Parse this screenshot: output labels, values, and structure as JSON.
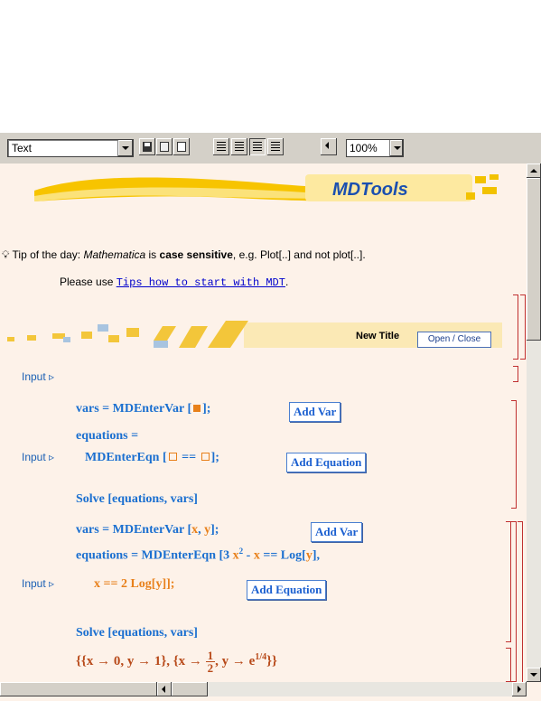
{
  "toolbar": {
    "style_value": "Text",
    "zoom_value": "100%"
  },
  "banner": {
    "logo_text": "MDTools"
  },
  "tip": {
    "prefix": "Tip of the day: ",
    "app": "Mathematica",
    "mid": " is ",
    "bold": "case sensitive",
    "suffix": ", e.g. Plot[..] and not plot[..]."
  },
  "please": {
    "prefix": "Please use ",
    "link": "Tips how to start with MDT",
    "suffix": "."
  },
  "section": {
    "title": "New Title",
    "open_close": "Open / Close"
  },
  "cells": {
    "input_label": "Input ▹",
    "cell1": {
      "vars_a": "vars = MDEnterVar [",
      "vars_b": "];",
      "add_var": "Add Var",
      "eq1": "equations =",
      "eq2_a": "MDEnterEqn [",
      "eq2_b": " == ",
      "eq2_c": "];",
      "add_eq": "Add Equation",
      "solve": "Solve [equations, vars]"
    },
    "cell2": {
      "vars_a": "vars = MDEnterVar [",
      "vars_x": "x",
      "vars_sep": ", ",
      "vars_y": "y",
      "vars_b": "];",
      "add_var": "Add Var",
      "eq1_a": "equations = MDEnterEqn [3 ",
      "eq1_x": "x",
      "eq1_exp": "2",
      "eq1_b": " - ",
      "eq1_c": " == Log[",
      "eq1_d": "],",
      "eq2_a": "x",
      "eq2_b": " == 2 Log[",
      "eq2_c": "y",
      "eq2_d": "]];",
      "add_eq": "Add Equation",
      "solve": "Solve [equations, vars]"
    },
    "output": {
      "p1": "{{x → 0, y → 1}, {x → ",
      "num": "1",
      "den": "2",
      "p2": ", y → e",
      "exp": "1/4",
      "p3": "}}"
    }
  },
  "colors": {
    "input_blue": "#1a6fd0",
    "orange": "#e8801a",
    "bracket_red": "#c03030",
    "background": "#fdf2e9"
  }
}
